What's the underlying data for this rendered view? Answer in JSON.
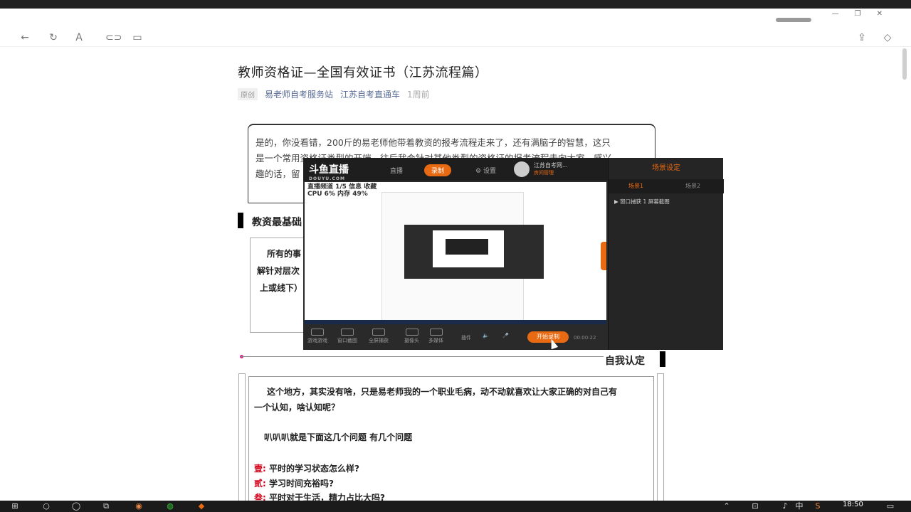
{
  "article": {
    "title": "教师资格证—全国有效证书（江苏流程篇）",
    "tag": "原创",
    "author": "易老师自考服务站",
    "account": "江苏自考直通车",
    "time": "1周前"
  },
  "intro": {
    "line1": "是的，你没看错，200斤的易老师他带着教资的报考流程走来了，还有满脑子的智慧，这只",
    "line2": "是一个常用资格证类型的开端，往后我会针对其他类型的资格证的报考流程走向大家，感兴",
    "line3": "趣的话，留"
  },
  "section1": {
    "title": "教资最基础",
    "l1": "所有的事",
    "l2": "解针对层次",
    "l3": "上或线下）"
  },
  "section2": {
    "title": "自我认定",
    "p1": "这个地方，其实没有啥，只是易老师我的一个职业毛病，动不动就喜欢让大家正确的对自己有",
    "p2": "一个认知，啥认知呢？",
    "p3": "叭叭叭就是下面这几个问题 有几个问题",
    "q1_label": "壹:",
    "q1": "平时的学习状态怎么样?",
    "q2_label": "贰:",
    "q2": "学习时间充裕吗?",
    "q3_label": "叁:",
    "q3": "平时对于生活，精力占比大吗?"
  },
  "recorder": {
    "logo": "斗鱼直播",
    "logo_sub": "DOUYU.COM",
    "tab_live": "直播",
    "tab_record": "录制",
    "settings": "设置",
    "user_name": "江苏自考网...",
    "user_status": "房间管理",
    "side_title": "场景设定",
    "side_tab1": "场景1",
    "side_tab2": "场景2",
    "side_item": "▶ 窗口捕获 1 屏幕截图",
    "preview_line1": "直播频道 1/5 信息 收藏",
    "preview_line2": "CPU 6% 内存 49%",
    "foot_game": "游戏游戏",
    "foot_window": "窗口截图",
    "foot_screen": "全屏捕获",
    "foot_camera": "摄像头",
    "foot_multi": "多媒体",
    "foot_plugin": "插件",
    "start": "开始录制",
    "timer": "00:00:22"
  },
  "taskbar": {
    "time": "18:50",
    "ime": "中"
  }
}
